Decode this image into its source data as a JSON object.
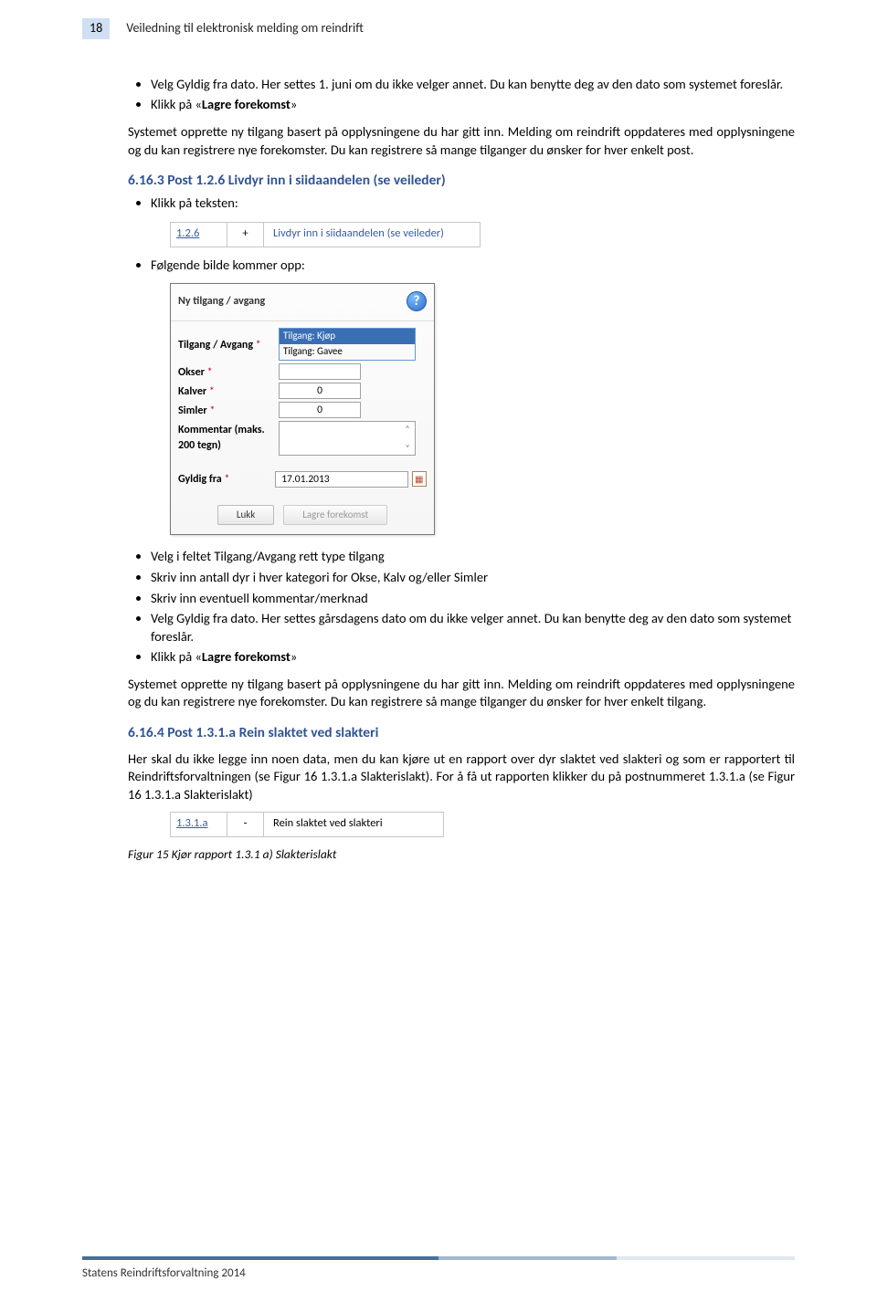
{
  "page_number": "18",
  "header_title": "Veiledning til elektronisk melding om reindrift",
  "block1": {
    "bullets": [
      "Velg Gyldig fra dato. Her settes 1. juni om du ikke velger annet. Du kan benytte deg av den dato som systemet foreslår.",
      "Klikk på «Lagre forekomst»"
    ],
    "bold_phrase": "Lagre forekomst",
    "para": "Systemet opprette ny tilgang basert på opplysningene du har gitt inn. Melding om reindrift oppdateres med opplysningene og du kan registrere nye forekomster. Du kan registrere så mange tilganger du ønsker for hver enkelt post."
  },
  "section1": {
    "heading": "6.16.3  Post 1.2.6 Livdyr inn i siidaandelen (se veileder)",
    "bullet_before_fig1": "Klikk på teksten:",
    "fig1": {
      "code": "1.2.6",
      "symbol": "+",
      "text": "Livdyr inn i siidaandelen (se veileder)"
    },
    "bullet_before_dialog": "Følgende bilde kommer opp:",
    "dialog": {
      "title": "Ny tilgang / avgang",
      "rows": {
        "tilgang_avgang_label": "Tilgang / Avgang",
        "dropdown_opts": [
          "Tilgang: Kjøp",
          "Tilgang: Gavee"
        ],
        "okser_label": "Okser",
        "kalver_label": "Kalver",
        "kalver_val": "0",
        "simler_label": "Simler",
        "simler_val": "0",
        "kommentar_label": "Kommentar (maks. 200 tegn)",
        "gyldig_label": "Gyldig fra",
        "gyldig_val": "17.01.2013"
      },
      "btn_lukk": "Lukk",
      "btn_lagre": "Lagre forekomst"
    },
    "bullets_after": [
      "Velg i feltet Tilgang/Avgang rett type tilgang",
      "Skriv inn antall dyr i hver kategori for Okse, Kalv og/eller Simler",
      "Skriv inn eventuell kommentar/merknad",
      "Velg Gyldig fra dato. Her settes gårsdagens dato om du ikke velger annet. Du kan benytte deg av den dato som systemet foreslår.",
      "Klikk på «Lagre forekomst»"
    ],
    "para_after": "Systemet opprette ny tilgang basert på opplysningene du har gitt inn. Melding om reindrift oppdateres med opplysningene og du kan registrere nye forekomster. Du kan registrere så mange tilganger du ønsker for hver enkelt tilgang."
  },
  "section2": {
    "heading": "6.16.4  Post 1.3.1.a Rein slaktet ved slakteri",
    "para": "Her skal du ikke legge inn noen data, men du kan kjøre ut en rapport over dyr slaktet ved slakteri og som er rapportert til Reindriftsforvaltningen (se Figur 16 1.3.1.a Slakterislakt).  For å få ut rapporten klikker du på postnummeret 1.3.1.a (se Figur 16 1.3.1.a Slakterislakt)",
    "fig": {
      "code": "1.3.1.a",
      "symbol": "-",
      "text": "Rein slaktet ved slakteri"
    },
    "caption": "Figur 15 Kjør rapport 1.3.1 a) Slakterislakt"
  },
  "footer": "Statens Reindriftsforvaltning 2014"
}
